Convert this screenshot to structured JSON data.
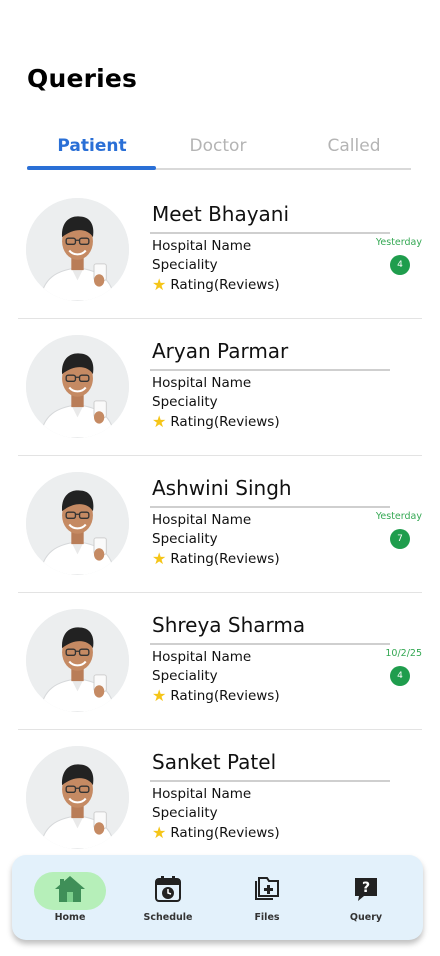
{
  "page": {
    "title": "Queries"
  },
  "tabs": [
    {
      "label": "Patient",
      "active": true
    },
    {
      "label": "Doctor",
      "active": false
    },
    {
      "label": "Called",
      "active": false
    }
  ],
  "queries": [
    {
      "name": "Meet Bhayani",
      "hospital": "Hospital Name",
      "speciality": "Speciality",
      "rating": "Rating(Reviews)",
      "time": "Yesterday",
      "badge": "4"
    },
    {
      "name": "Aryan Parmar",
      "hospital": "Hospital Name",
      "speciality": "Speciality",
      "rating": "Rating(Reviews)",
      "time": "",
      "badge": ""
    },
    {
      "name": "Ashwini Singh",
      "hospital": "Hospital Name",
      "speciality": "Speciality",
      "rating": "Rating(Reviews)",
      "time": "Yesterday",
      "badge": "7"
    },
    {
      "name": "Shreya Sharma",
      "hospital": "Hospital Name",
      "speciality": "Speciality",
      "rating": "Rating(Reviews)",
      "time": "10/2/25",
      "badge": "4"
    },
    {
      "name": "Sanket Patel",
      "hospital": "Hospital Name",
      "speciality": "Speciality",
      "rating": "Rating(Reviews)",
      "time": "",
      "badge": ""
    }
  ],
  "nav": {
    "home": "Home",
    "schedule": "Schedule",
    "files": "Files",
    "query": "Query"
  },
  "icons": {
    "star": "star-icon",
    "home": "home-icon",
    "schedule": "calendar-clock-icon",
    "files": "files-add-icon",
    "query": "question-chat-icon"
  },
  "colors": {
    "accent": "#2a6fd6",
    "badge": "#1f9d4d",
    "time": "#34a853",
    "star": "#f5c518",
    "nav_bg": "#e3f1fb",
    "home_pill": "#b6efb9"
  }
}
